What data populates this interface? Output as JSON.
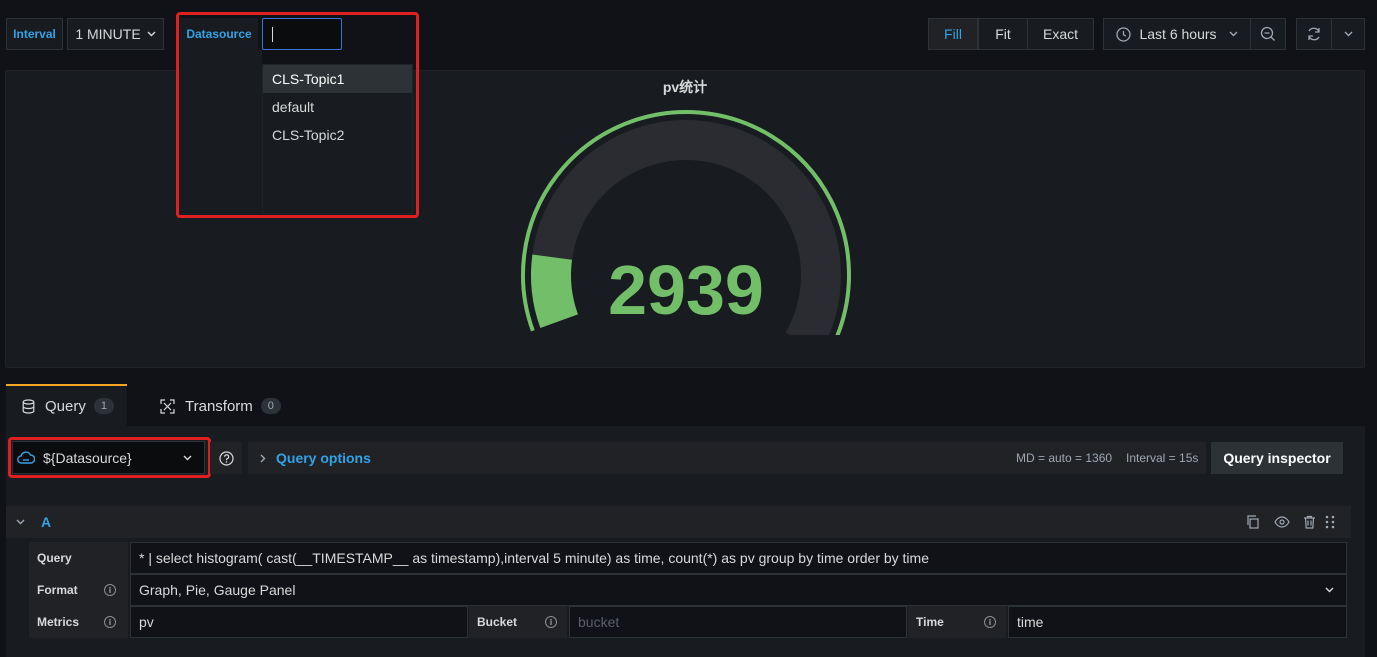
{
  "toolbar": {
    "interval_label": "Interval",
    "interval_value": "1 MINUTE",
    "datasource_label": "Datasource",
    "datasource_input_value": "",
    "fill": "Fill",
    "fit": "Fit",
    "exact": "Exact",
    "time_range": "Last 6 hours"
  },
  "datasource_dropdown": {
    "options": [
      "CLS-Topic1",
      "default",
      "CLS-Topic2"
    ]
  },
  "panel": {
    "title": "pv统计",
    "value": "2939",
    "gauge_fraction": 0.12,
    "gauge_color": "#73bf69",
    "track_color": "#2a2c31"
  },
  "tabs": [
    {
      "label": "Query",
      "count": "1"
    },
    {
      "label": "Transform",
      "count": "0"
    }
  ],
  "query_bar": {
    "datasource_select": "${Datasource}",
    "query_options": "Query options",
    "md": "MD = auto = 1360",
    "interval": "Interval = 15s",
    "inspector": "Query inspector"
  },
  "query_row": {
    "ref": "A",
    "query_label": "Query",
    "query_value": "* | select histogram( cast(__TIMESTAMP__ as timestamp),interval 5 minute) as time, count(*) as pv group by time order by time",
    "format_label": "Format",
    "format_value": "Graph, Pie, Gauge Panel",
    "metrics_label": "Metrics",
    "metrics_value": "pv",
    "bucket_label": "Bucket",
    "bucket_placeholder": "bucket",
    "time_label": "Time",
    "time_value": "time"
  },
  "colors": {
    "accent_blue": "#33a2e5",
    "highlight_red": "#e02020",
    "tab_active_orange": "#f5a623"
  }
}
